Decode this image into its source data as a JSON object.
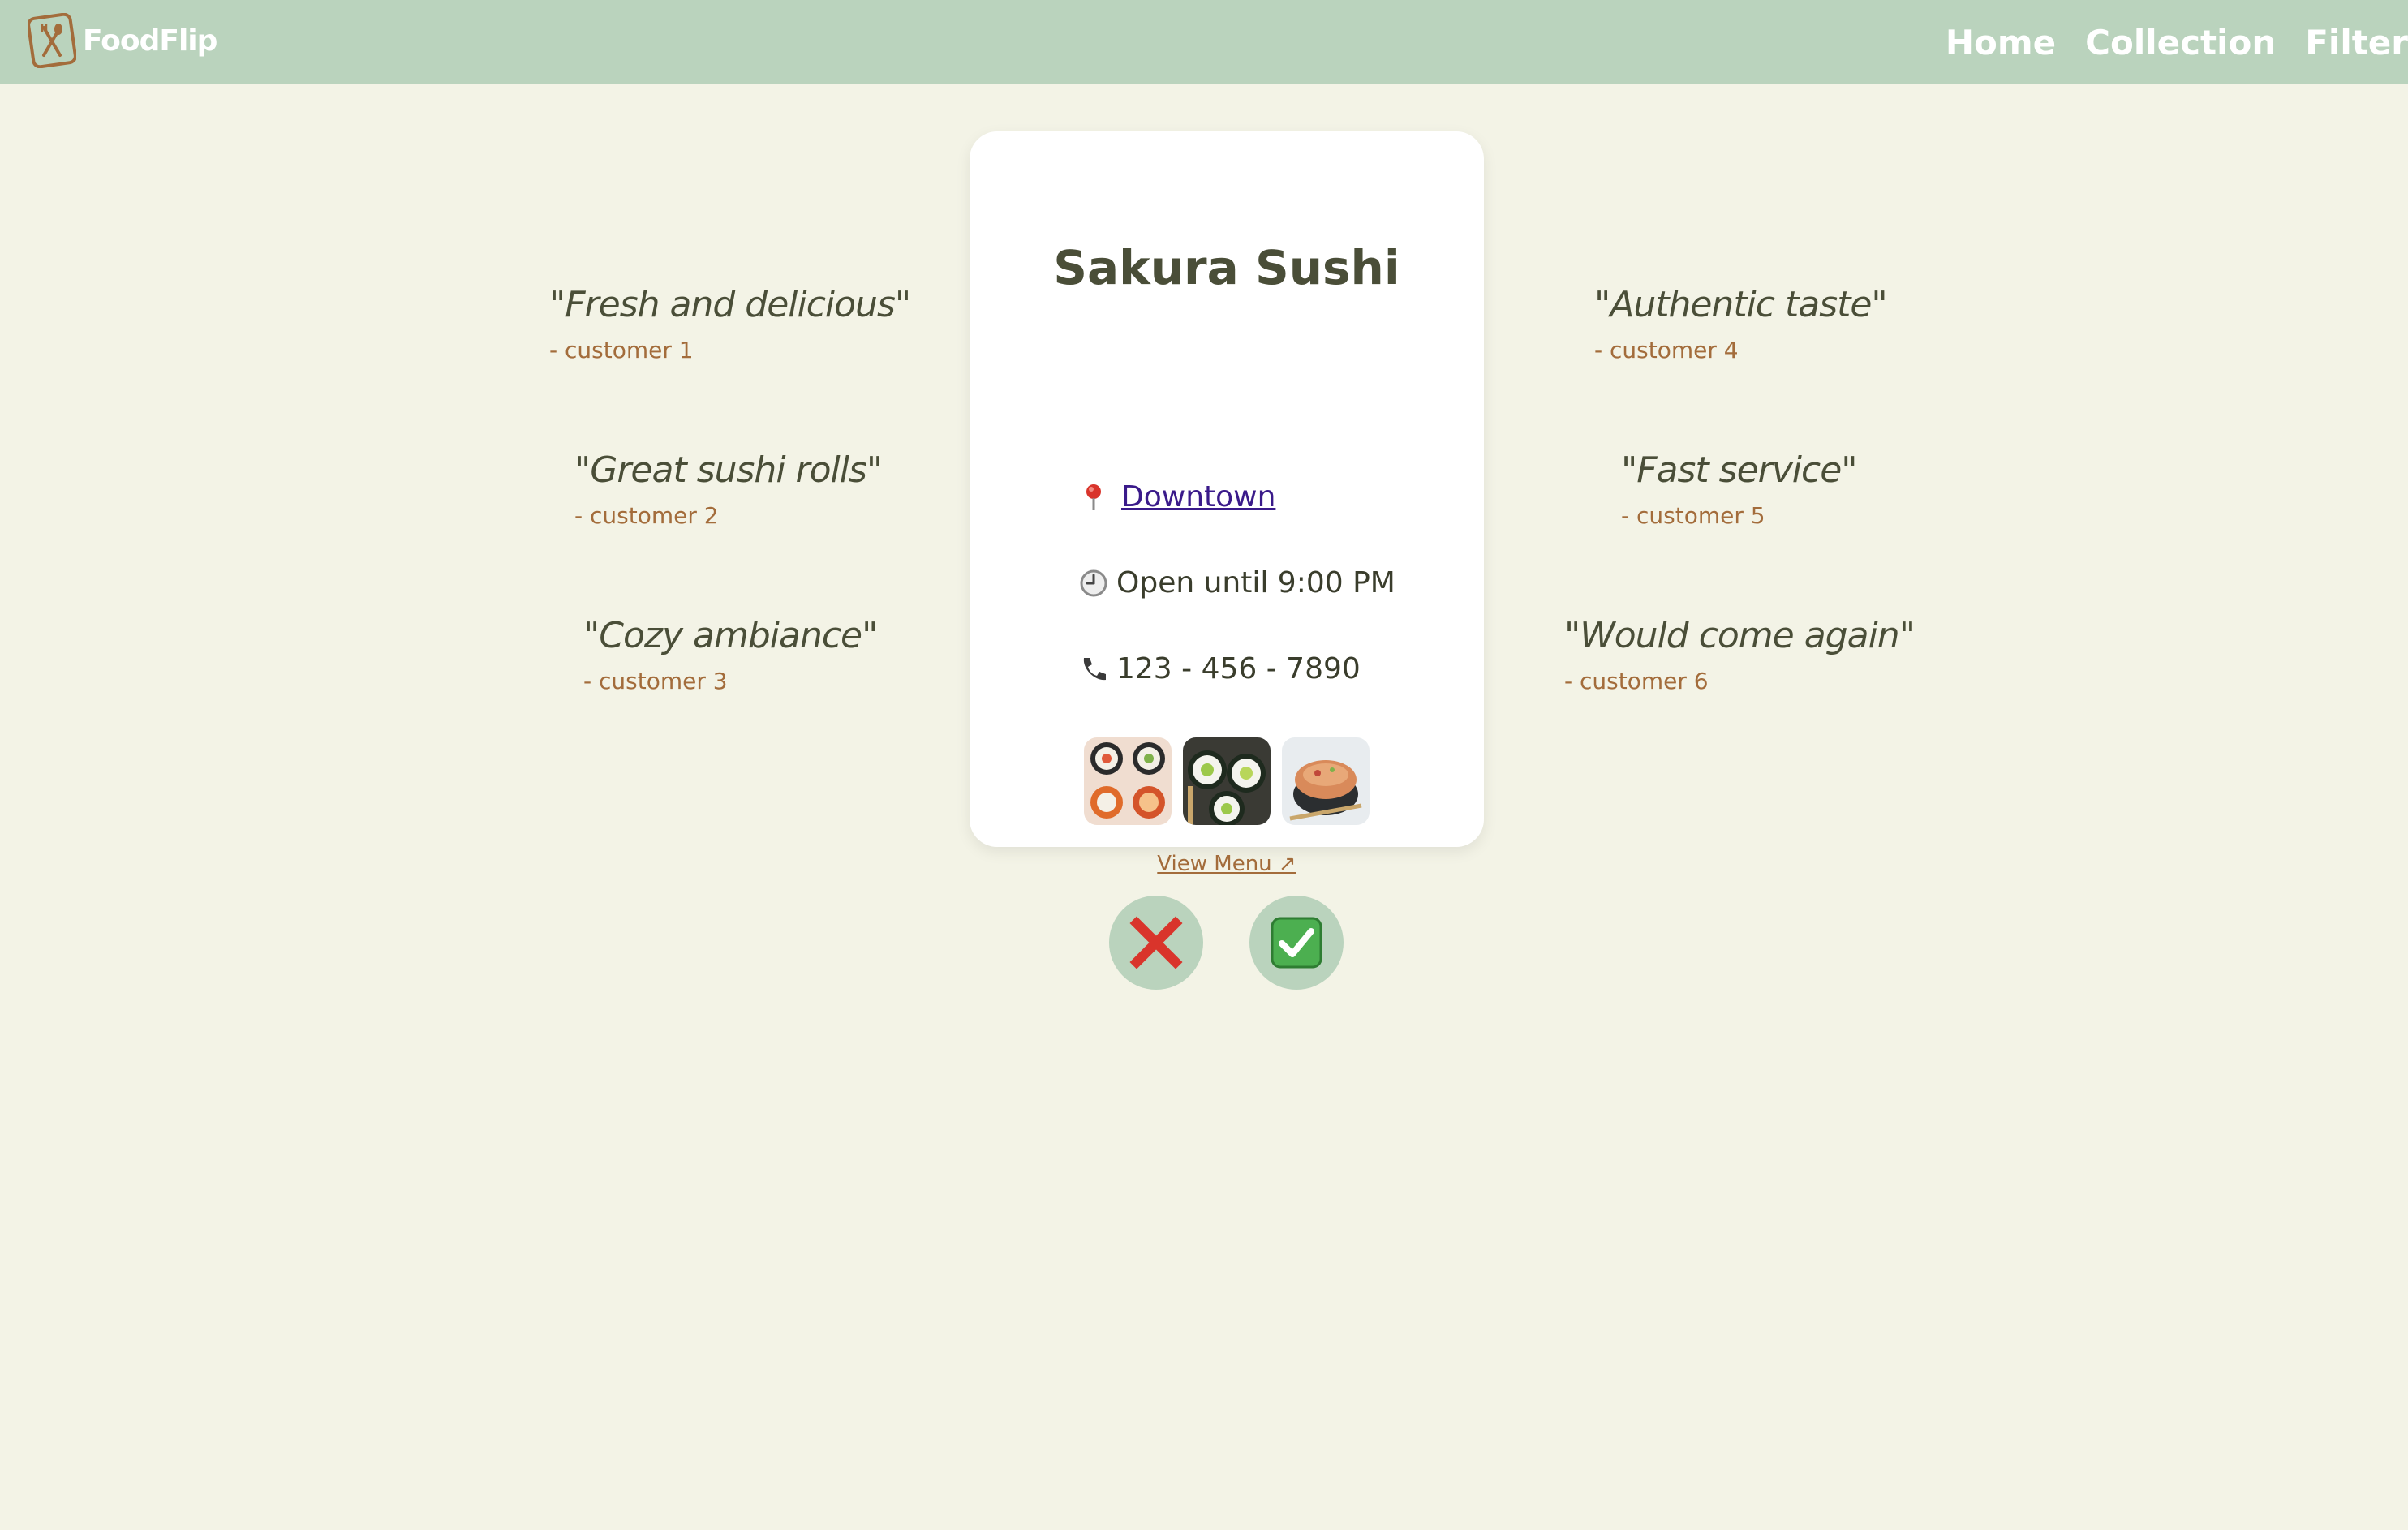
{
  "app": {
    "name": "FoodFlip"
  },
  "nav": {
    "items": [
      {
        "label": "Home"
      },
      {
        "label": "Collection"
      },
      {
        "label": "Filter"
      }
    ]
  },
  "restaurant": {
    "name": "Sakura Sushi",
    "location_icon": "pin-icon",
    "location": "Downtown",
    "hours_icon": "clock-icon",
    "hours": "Open until 9:00 PM",
    "phone_icon": "phone-icon",
    "phone": "123 - 456 - 7890",
    "photos": [
      {
        "name": "sushi-photo-1"
      },
      {
        "name": "sushi-photo-2"
      },
      {
        "name": "sushi-photo-3"
      }
    ],
    "menu_link": "View Menu ↗"
  },
  "reviews": {
    "left": [
      {
        "quote": "\"Fresh and delicious\"",
        "author": "- customer 1"
      },
      {
        "quote": "\"Great sushi rolls\"",
        "author": "- customer 2"
      },
      {
        "quote": "\"Cozy ambiance\"",
        "author": "- customer 3"
      }
    ],
    "right": [
      {
        "quote": "\"Authentic taste\"",
        "author": "- customer 4"
      },
      {
        "quote": "\"Fast service\"",
        "author": "- customer 5"
      },
      {
        "quote": "\"Would come again\"",
        "author": "- customer 6"
      }
    ]
  },
  "actions": {
    "reject_icon": "cross-mark-icon",
    "accept_icon": "check-mark-icon"
  },
  "colors": {
    "navbar": "#bad3bd",
    "background": "#f3f3e6",
    "accent": "#a36c3b",
    "text": "#4a4e38",
    "reject": "#d9342b",
    "accept": "#4caf50"
  }
}
